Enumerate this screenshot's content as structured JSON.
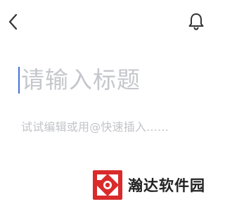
{
  "header": {
    "back_icon": "chevron-left-icon",
    "notification_icon": "bell-icon"
  },
  "editor": {
    "title_placeholder": "请输入标题",
    "body_placeholder": "试试编辑或用@快速插入......"
  },
  "watermark": {
    "text": "瀚达软件园",
    "logo_color": "#d92b2b"
  },
  "colors": {
    "caret": "#4a6fd8",
    "placeholder": "#c5c7cc"
  }
}
